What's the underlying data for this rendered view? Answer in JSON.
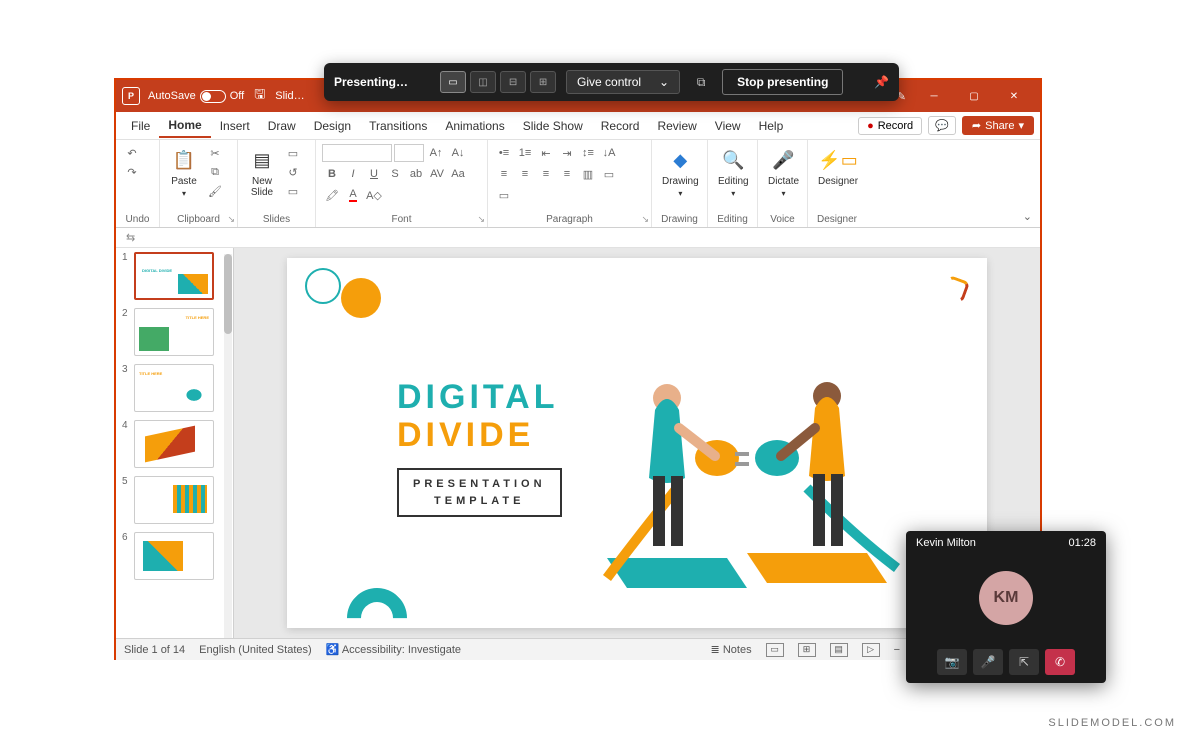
{
  "titlebar": {
    "autosave_label": "AutoSave",
    "autosave_state": "Off",
    "doc_name": "Slid…"
  },
  "menu": {
    "tabs": [
      "File",
      "Home",
      "Insert",
      "Draw",
      "Design",
      "Transitions",
      "Animations",
      "Slide Show",
      "Record",
      "Review",
      "View",
      "Help"
    ],
    "active_index": 1,
    "record_label": "Record",
    "share_label": "Share"
  },
  "ribbon": {
    "groups": {
      "undo": "Undo",
      "clipboard": "Clipboard",
      "paste": "Paste",
      "slides": "Slides",
      "new_slide": "New\nSlide",
      "font": "Font",
      "paragraph": "Paragraph",
      "drawing": "Drawing",
      "editing": "Editing",
      "voice": "Voice",
      "dictate": "Dictate",
      "designer": "Designer",
      "designer_btn": "Designer"
    }
  },
  "thumbnails": [
    {
      "num": "1",
      "label": "DIGITAL DIVIDE"
    },
    {
      "num": "2",
      "label": "TITLE HERE"
    },
    {
      "num": "3",
      "label": "TITLE HERE"
    },
    {
      "num": "4",
      "label": ""
    },
    {
      "num": "5",
      "label": ""
    },
    {
      "num": "6",
      "label": ""
    }
  ],
  "slide": {
    "title_line1": "DIGITAL",
    "title_line2": "DIVIDE",
    "subtitle_line1": "PRESENTATION",
    "subtitle_line2": "TEMPLATE"
  },
  "statusbar": {
    "slide_info": "Slide 1 of 14",
    "language": "English (United States)",
    "accessibility": "Accessibility: Investigate",
    "notes": "Notes"
  },
  "presenting": {
    "label": "Presenting…",
    "give_control": "Give control",
    "stop": "Stop presenting"
  },
  "call": {
    "name": "Kevin Milton",
    "duration": "01:28",
    "initials": "KM"
  },
  "watermark": "SLIDEMODEL.COM"
}
